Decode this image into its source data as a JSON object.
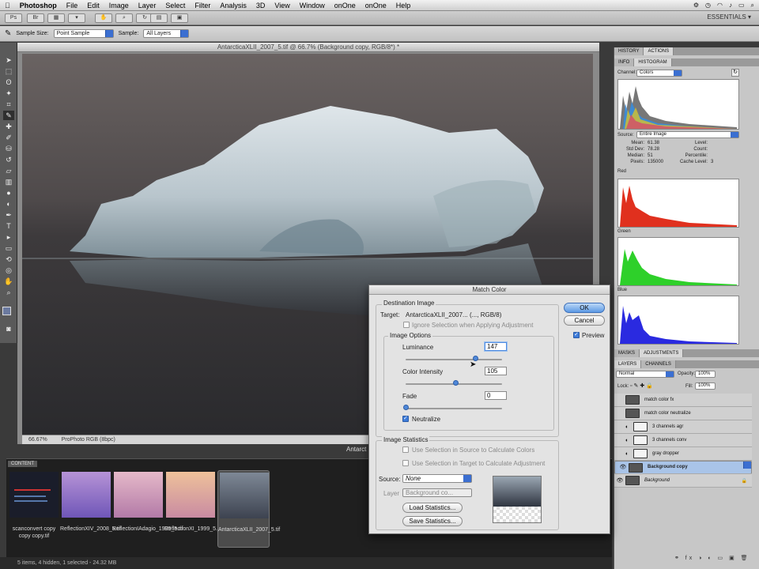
{
  "menubar": {
    "apple": "",
    "items": [
      "Photoshop",
      "File",
      "Edit",
      "Image",
      "Layer",
      "Select",
      "Filter",
      "Analysis",
      "3D",
      "View",
      "Window",
      "onOne",
      "onOne",
      "Help"
    ]
  },
  "appbar": {
    "workspace": "ESSENTIALS ▾"
  },
  "options": {
    "sample_size_label": "Sample Size:",
    "sample_size_value": "Point Sample",
    "sample_label": "Sample:",
    "sample_value": "All Layers"
  },
  "document": {
    "title": "AntarcticaXLII_2007_5.tif @ 66.7% (Background copy, RGB/8*) *",
    "zoom": "66.67%",
    "profile": "ProPhoto RGB (8bpc)",
    "caption_partial": "Antarct"
  },
  "panels": {
    "top_tabs": [
      "HISTORY",
      "ACTIONS"
    ],
    "info_tabs": [
      "INFO",
      "HISTOGRAM"
    ],
    "channel_label": "Channel:",
    "channel_value": "Colors",
    "source_label": "Source:",
    "source_value": "Entire Image",
    "stats": [
      {
        "k": "Mean:",
        "v": "61.38",
        "k2": "Level:",
        "v2": ""
      },
      {
        "k": "Std Dev:",
        "v": "78.28",
        "k2": "Count:",
        "v2": ""
      },
      {
        "k": "Median:",
        "v": "51",
        "k2": "Percentile:",
        "v2": ""
      },
      {
        "k": "Pixels:",
        "v": "135000",
        "k2": "Cache Level:",
        "v2": "3"
      }
    ],
    "channels": [
      "Red",
      "Green",
      "Blue"
    ],
    "adj_tabs": [
      "MASKS",
      "ADJUSTMENTS"
    ],
    "layers_tabs": [
      "LAYERS",
      "CHANNELS"
    ],
    "blend_mode": "Normal",
    "opacity_label": "Opacity:",
    "opacity_value": "100%",
    "lock_label": "Lock:",
    "fill_label": "Fill:",
    "fill_value": "100%",
    "layers": [
      {
        "name": "match color fx",
        "selected": false
      },
      {
        "name": "match color neutralize",
        "selected": false
      },
      {
        "name": "3 channels agr",
        "selected": false
      },
      {
        "name": "3 channels conv",
        "selected": false
      },
      {
        "name": "gray dropper",
        "selected": false
      },
      {
        "name": "Background copy",
        "selected": true
      },
      {
        "name": "Background",
        "selected": false
      }
    ]
  },
  "content": {
    "tab": "CONTENT",
    "items": [
      {
        "label": "scanconvert copy copy copy.tif",
        "color": "#1a1d2a"
      },
      {
        "label": "ReflectionXIV_2008_5.tif",
        "color": "#8a6cc9"
      },
      {
        "label": "ReflectionIAdagio_1999_5.tif",
        "color": "#c98fb7"
      },
      {
        "label": "ReflectionXI_1999_5.jpg",
        "color": "#d6a27a"
      },
      {
        "label": "AntarcticaXLII_2007_5.tif",
        "color": "#6f7f95"
      }
    ],
    "status": "5 items, 4 hidden, 1 selected - 24.32 MB"
  },
  "dialog": {
    "title": "Match Color",
    "dest_group": "Destination Image",
    "target_label": "Target:",
    "target_value": "AntarcticaXLII_2007... (..., RGB/8)",
    "ignore_selection": "Ignore Selection when Applying Adjustment",
    "image_options": "Image Options",
    "luminance_label": "Luminance",
    "luminance_value": "147",
    "color_intensity_label": "Color Intensity",
    "color_intensity_value": "105",
    "fade_label": "Fade",
    "fade_value": "0",
    "neutralize_label": "Neutralize",
    "stats_group": "Image Statistics",
    "use_sel_source": "Use Selection in Source to Calculate Colors",
    "use_sel_target": "Use Selection in Target to Calculate Adjustment",
    "source_label": "Source:",
    "source_value": "None",
    "layer_label": "Layer",
    "layer_value": "Background co...",
    "load_stats": "Load Statistics...",
    "save_stats": "Save Statistics...",
    "ok": "OK",
    "cancel": "Cancel",
    "preview": "Preview"
  }
}
